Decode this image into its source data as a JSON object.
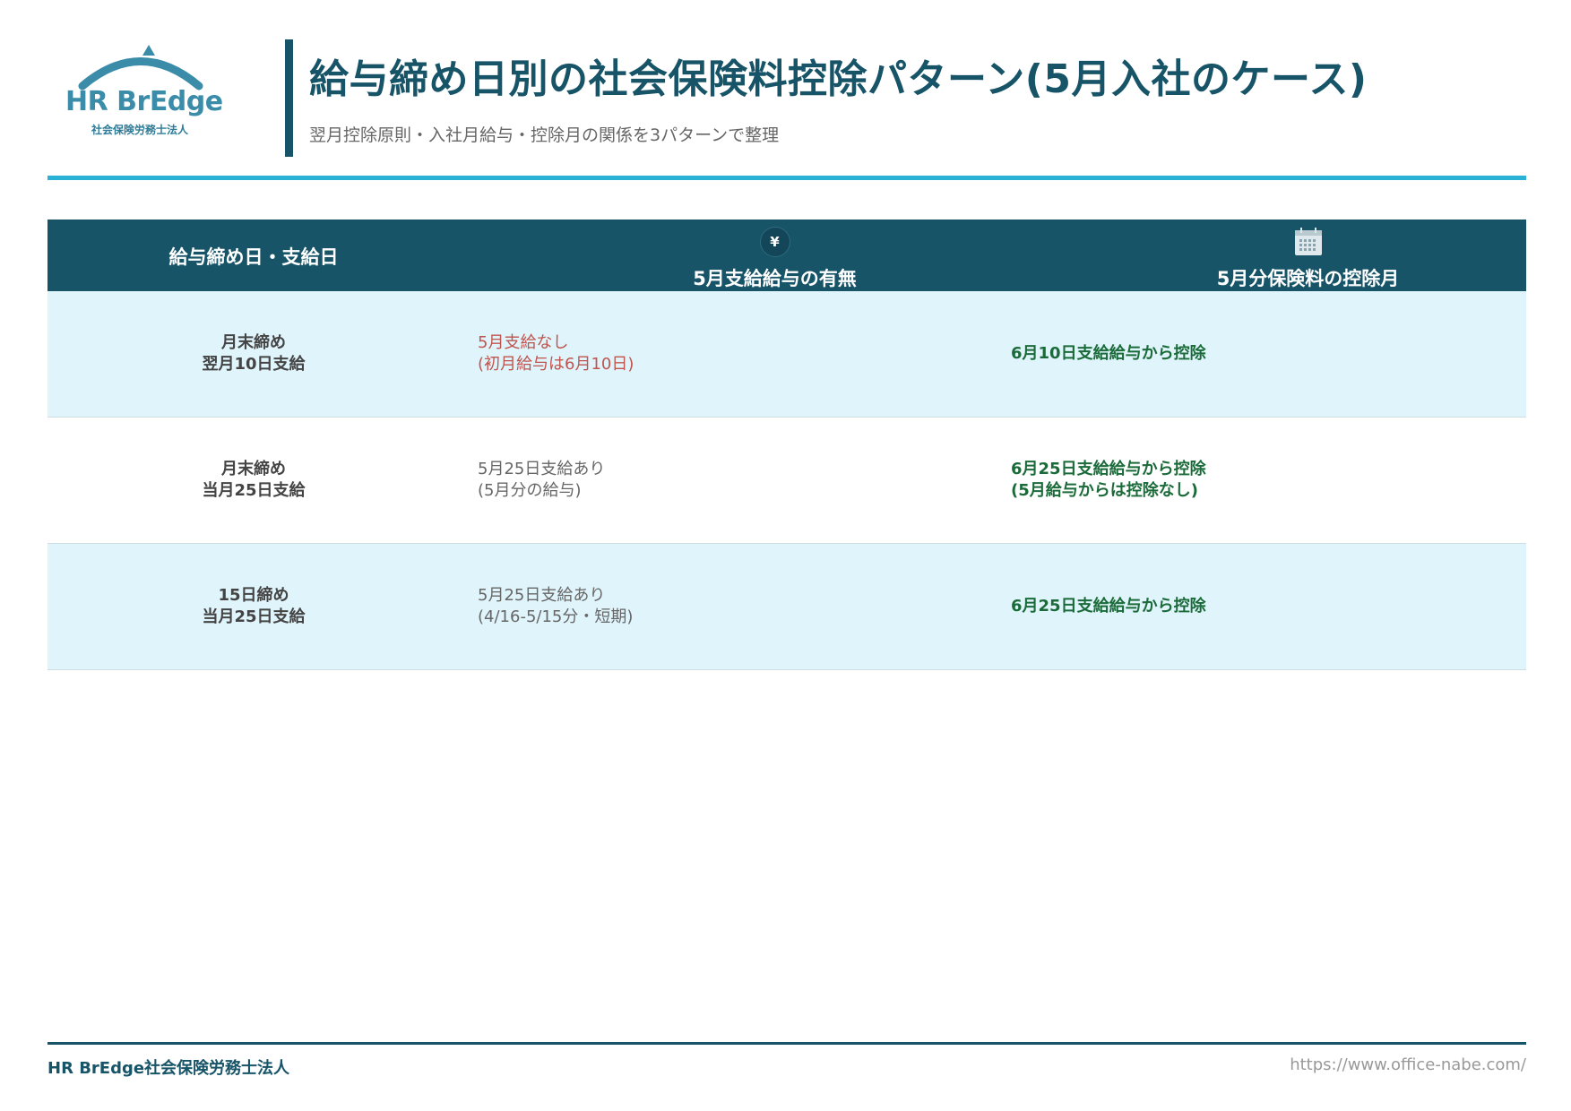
{
  "logo": {
    "brand": "HR BrEdge",
    "sub": "社会保険労務士法人"
  },
  "title": "給与締め日別の社会保険料控除パターン(5月入社のケース)",
  "subtitle": "翌月控除原則・入社月給与・控除月の関係を3パターンで整理",
  "table": {
    "headers": [
      {
        "label": "給与締め日・支給日",
        "icon": ""
      },
      {
        "label": "5月支給給与の有無",
        "icon": "yen-icon",
        "icon_text": "¥"
      },
      {
        "label": "5月分保険料の控除月",
        "icon": "calendar-icon"
      }
    ],
    "rows": [
      {
        "schedule": [
          "月末締め",
          "翌月10日支給"
        ],
        "may_pay": [
          "5月支給なし",
          "(初月給与は6月10日)"
        ],
        "deduction": [
          "6月10日支給給与から控除"
        ]
      },
      {
        "schedule": [
          "月末締め",
          "当月25日支給"
        ],
        "may_pay": [
          "5月25日支給あり",
          "(5月分の給与)"
        ],
        "deduction": [
          "6月25日支給給与から控除",
          "(5月給与からは控除なし)"
        ]
      },
      {
        "schedule": [
          "15日締め",
          "当月25日支給"
        ],
        "may_pay": [
          "5月25日支給あり",
          "(4/16-5/15分・短期)"
        ],
        "deduction": [
          "6月25日支給給与から控除"
        ]
      }
    ]
  },
  "footer": {
    "org": "HR BrEdge社会保険労務士法人",
    "url": "https://www.office-nabe.com/"
  },
  "colors": {
    "primary": "#175468",
    "accent": "#2ab2d6",
    "row_alt": "#e0f4fb",
    "negative": "#c0554f",
    "deduction": "#1b6b3a"
  }
}
